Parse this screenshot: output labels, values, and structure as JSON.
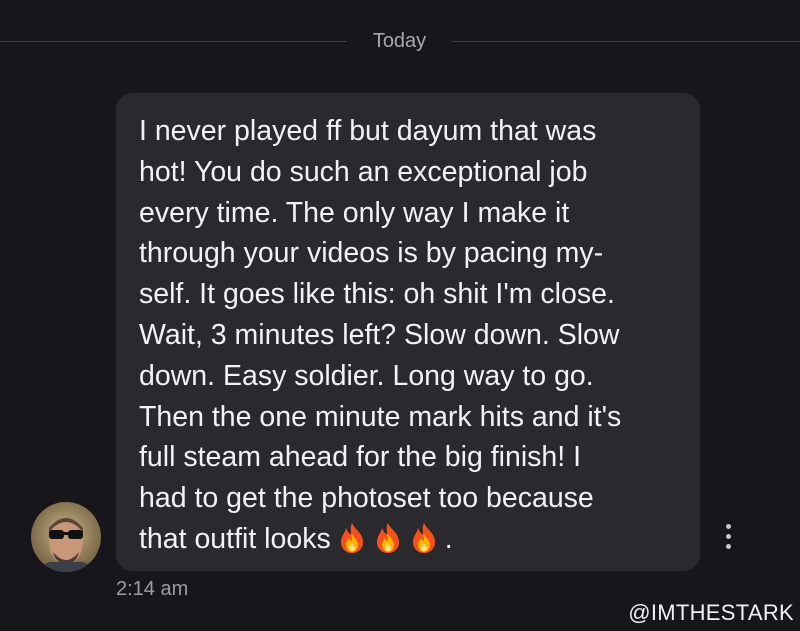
{
  "conversation": {
    "date_divider": "Today"
  },
  "message": {
    "lines": [
      "I never played ff but dayum that was",
      "hot! You do such an exceptional job",
      "every time. The only way I make it",
      "through your videos is by pacing my-",
      "self. It goes like this: oh shit I'm close.",
      "Wait, 3 minutes left? Slow down. Slow",
      "down. Easy soldier. Long way to go.",
      "Then the one minute mark hits and it's",
      "full steam ahead for the big finish! I",
      "had to get the photoset too because",
      "that outfit looks"
    ],
    "trailing_emoji": [
      "fire-emoji",
      "fire-emoji",
      "fire-emoji"
    ],
    "trailing_text": ".",
    "timestamp": "2:14 am",
    "actions_icon": "more-vertical-icon"
  },
  "sender": {
    "avatar_icon": "avatar"
  },
  "watermark": "@IMTHESTARK",
  "colors": {
    "background": "#17161b",
    "bubble": "#2a292e",
    "text": "#f2f2f4",
    "muted": "#9e9da3",
    "divider": "#3e3d43"
  }
}
